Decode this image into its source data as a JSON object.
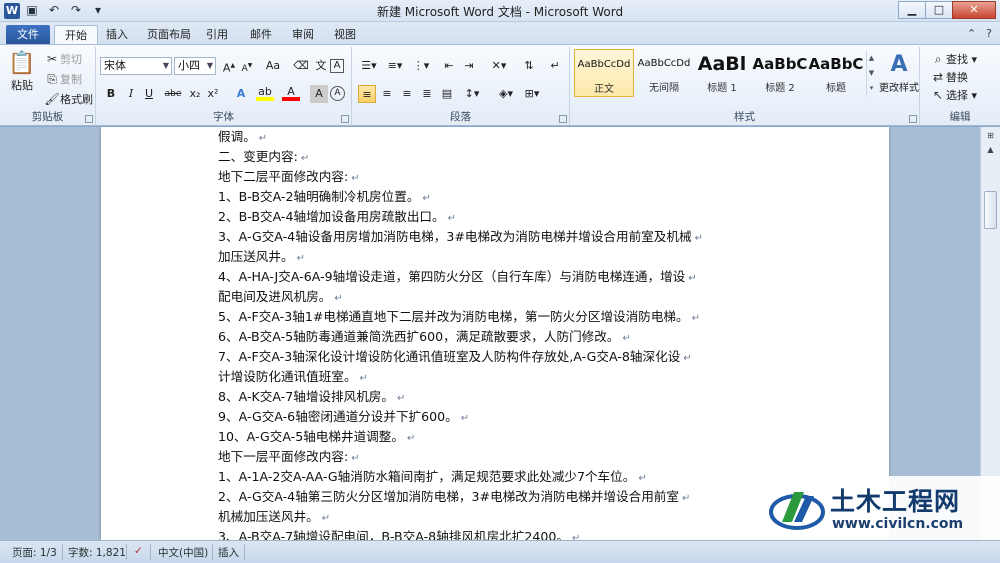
{
  "window": {
    "title": "新建 Microsoft Word 文档 - Microsoft Word",
    "app_icon": "W",
    "controls": [
      "minimize-icon",
      "maximize-icon",
      "close-icon"
    ]
  },
  "qat": [
    "save-icon",
    "undo-icon",
    "redo-icon",
    "customize-icon"
  ],
  "tabs": {
    "file": "文件",
    "home": "开始",
    "insert": "插入",
    "layout": "页面布局",
    "references": "引用",
    "mailings": "邮件",
    "review": "审阅",
    "view": "视图"
  },
  "clipboard": {
    "paste": "粘贴",
    "cut": "剪切",
    "copy": "复制",
    "format_painter": "格式刷",
    "group": "剪贴板"
  },
  "font": {
    "name": "宋体",
    "size": "小四",
    "grow": "A",
    "shrink": "A",
    "case": "Aa",
    "buttons": [
      "B",
      "I",
      "U",
      "abe",
      "x₂",
      "x²",
      "A",
      "A",
      "A",
      "A"
    ],
    "group": "字体"
  },
  "paragraph": {
    "group": "段落"
  },
  "styles": {
    "items": [
      {
        "sample": "AaBbCcDd",
        "name": "正文"
      },
      {
        "sample": "AaBbCcDd",
        "name": "无间隔"
      },
      {
        "sample": "AaBl",
        "name": "标题 1"
      },
      {
        "sample": "AaBbC",
        "name": "标题 2"
      },
      {
        "sample": "AaBbC",
        "name": "标题"
      }
    ],
    "change_styles": "更改样式",
    "group": "样式"
  },
  "editing": {
    "find": "查找",
    "replace": "替换",
    "select": "选择",
    "group": "编辑"
  },
  "document": {
    "lines": [
      "假调。",
      "二、变更内容:",
      "地下二层平面修改内容:",
      "1、B-B交A-2轴明确制冷机房位置。",
      "2、B-B交A-4轴增加设备用房疏散出口。",
      "3、A-G交A-4轴设备用房增加消防电梯，3#电梯改为消防电梯并增设合用前室及机械",
      "加压送风井。",
      "4、A-HA-J交A-6A-9轴增设走道，第四防火分区（自行车库）与消防电梯连通，增设",
      "配电间及进风机房。",
      "5、A-F交A-3轴1#电梯通直地下二层并改为消防电梯，第一防火分区增设消防电梯。",
      "6、A-B交A-5轴防毒通道兼简洗西扩600，满足疏散要求，人防门修改。",
      "7、A-F交A-3轴深化设计增设防化通讯值班室及人防构件存放处,A-G交A-8轴深化设",
      "计增设防化通讯值班室。",
      "8、A-K交A-7轴增设排风机房。",
      "9、A-G交A-6轴密闭通道分设并下扩600。",
      "10、A-G交A-5轴电梯井道调整。",
      "地下一层平面修改内容:",
      "1、A-1A-2交A-AA-G轴消防水箱间南扩，满足规范要求此处减少7个车位。",
      "2、A-G交A-4轴第三防火分区增加消防电梯，3#电梯改为消防电梯并增设合用前室",
      "机械加压送风井。",
      "3、A-B交A-7轴增设配电间，B-B交A-8轴排风机房北扩2400。"
    ],
    "paragraph_mark": "↵"
  },
  "status": {
    "page": "页面: 1/3",
    "words": "字数: 1,821",
    "language": "中文(中国)",
    "mode": "插入"
  },
  "watermark": {
    "title": "土木工程网",
    "url": "www.civilcn.com"
  },
  "colors": {
    "file_tab": "#2a5699",
    "highlight": "#ffff00",
    "font_color": "#ff0000",
    "watermark_blue": "#123a6d"
  }
}
